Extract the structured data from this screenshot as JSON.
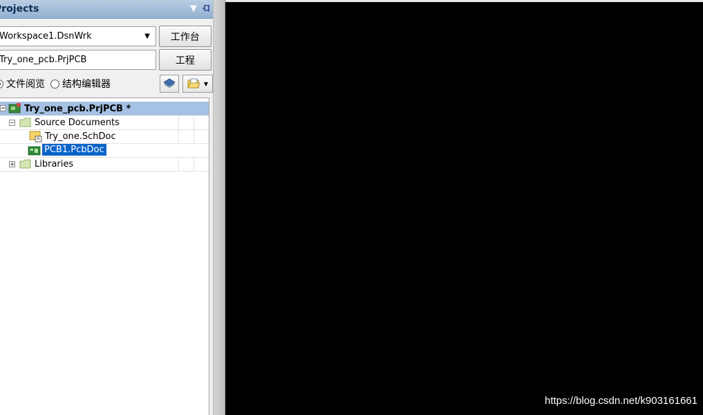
{
  "panel": {
    "title": "Projects",
    "icons": [
      "dropdown-arrow-icon",
      "pin-icon",
      "close-icon"
    ]
  },
  "workspace": {
    "value": "Workspace1.DsnWrk",
    "button_label": "工作台"
  },
  "project": {
    "value": "Try_one_pcb.PrjPCB",
    "button_label": "工程"
  },
  "view_mode": {
    "options": [
      {
        "label": "文件阅览",
        "selected": true
      },
      {
        "label": "结构编辑器",
        "selected": false
      }
    ]
  },
  "tree": {
    "project_node": {
      "label": "Try_one_pcb.PrjPCB *",
      "expanded": true
    },
    "source_folder": {
      "label": "Source Documents",
      "expanded": true
    },
    "documents": [
      {
        "label": "Try_one.SchDoc",
        "icon": "schematic-doc-icon",
        "selected": false
      },
      {
        "label": "PCB1.PcbDoc",
        "icon": "pcb-doc-icon",
        "selected": true
      }
    ],
    "libraries_folder": {
      "label": "Libraries",
      "expanded": false
    }
  },
  "watermark": "https://blog.csdn.net/k903161661",
  "colors": {
    "title_bar": "#93b1d2",
    "selection": "#0a64c8",
    "project_row": "#a5c1e3",
    "editor_bg": "#000000"
  }
}
